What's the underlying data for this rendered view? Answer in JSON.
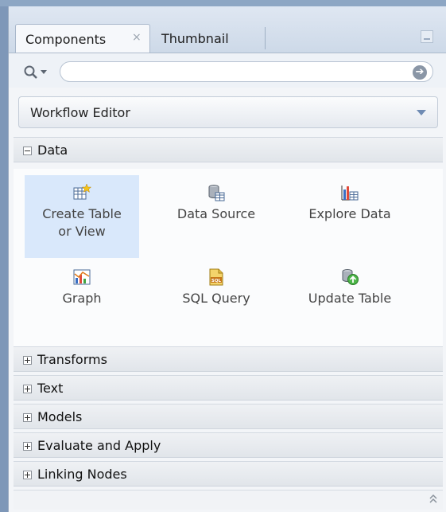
{
  "tabs": {
    "components": "Components",
    "close_glyph": "×",
    "thumbnail": "Thumbnail"
  },
  "search": {
    "placeholder": "",
    "value": ""
  },
  "palette": {
    "selected": "Workflow Editor"
  },
  "sections": {
    "data": "Data",
    "transforms": "Transforms",
    "text": "Text",
    "models": "Models",
    "evaluate": "Evaluate and Apply",
    "linking": "Linking Nodes"
  },
  "data_items": {
    "create_table_1": "Create Table",
    "create_table_2": "or View",
    "data_source": "Data Source",
    "explore_data": "Explore Data",
    "graph": "Graph",
    "sql_query": "SQL Query",
    "sql_icon_text": "SQL",
    "update_table": "Update Table"
  },
  "icons": [
    "search-icon",
    "go-icon",
    "minimize-icon",
    "chevron-down-icon",
    "create-table-icon",
    "data-source-icon",
    "explore-data-icon",
    "graph-icon",
    "sql-query-icon",
    "update-table-icon",
    "scroll-up-icon"
  ],
  "colors": {
    "selected_bg": "#d9e8fb",
    "accent": "#6f8bb3"
  }
}
